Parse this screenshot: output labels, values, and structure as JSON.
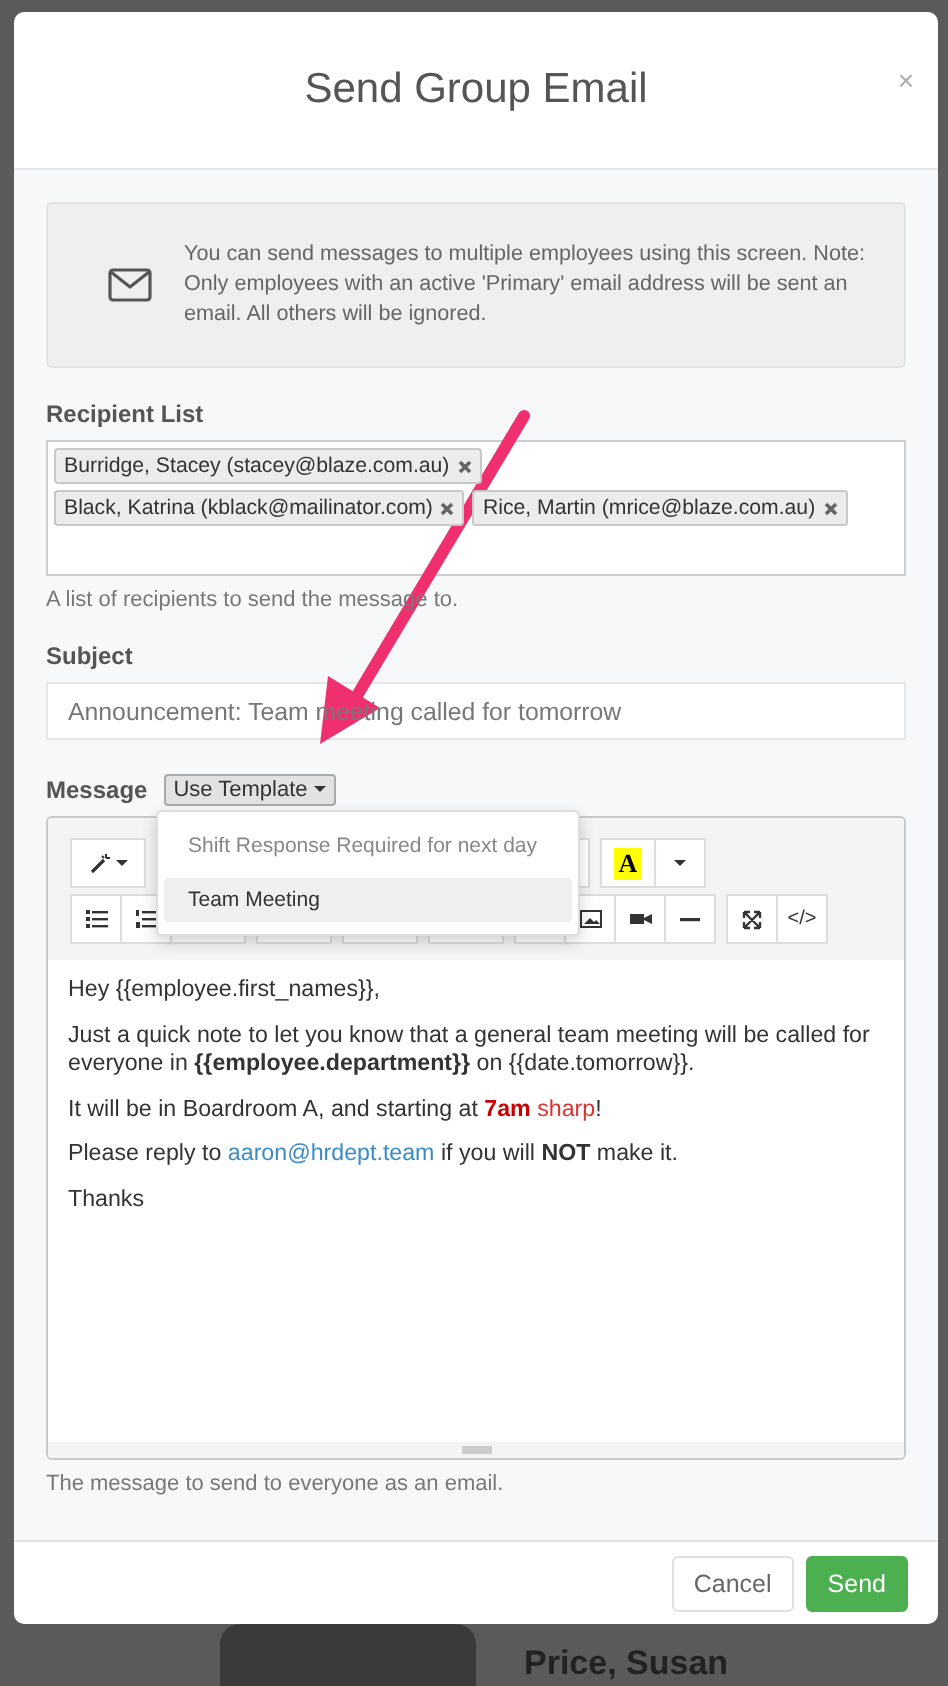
{
  "window": {
    "title": "Send Group Email",
    "close": "×"
  },
  "info": {
    "text": "You can send messages to multiple employees using this screen. Note: Only employees with an active 'Primary' email address will be sent an email. All others will be ignored."
  },
  "recipients": {
    "label": "Recipient List",
    "tokens": [
      {
        "text": "Burridge, Stacey (stacey@blaze.com.au)"
      },
      {
        "text": "Black, Katrina (kblack@mailinator.com)"
      },
      {
        "text": "Rice, Martin (mrice@blaze.com.au)"
      }
    ],
    "help": "A list of recipients to send the message to."
  },
  "subject": {
    "label": "Subject",
    "value": "Announcement: Team meeting called for tomorrow"
  },
  "message": {
    "label": "Message",
    "template_button": "Use Template",
    "templates": [
      {
        "label": "Shift Response Required for next day",
        "selected": false
      },
      {
        "label": "Team Meeting",
        "selected": true
      }
    ],
    "toolbar": {
      "highlight_glyph": "A",
      "code_glyph": "</>"
    },
    "paragraphs": [
      [
        {
          "kind": "plain",
          "text": "Hey {{employee.first_names}},"
        }
      ],
      [
        {
          "kind": "plain",
          "text": "Just a quick note to let you know that a general team meeting will be called for everyone in "
        },
        {
          "kind": "strong",
          "text": "{{employee.department}}"
        },
        {
          "kind": "plain",
          "text": " on {{date.tomorrow}}."
        }
      ],
      [
        {
          "kind": "plain",
          "text": "It will be in Boardroom A, and starting at "
        },
        {
          "kind": "alert-strong",
          "text": "7am"
        },
        {
          "kind": "alert",
          "text": " sharp"
        },
        {
          "kind": "plain",
          "text": "!"
        }
      ],
      [
        {
          "kind": "plain",
          "text": "Please reply to "
        },
        {
          "kind": "link",
          "text": "aaron@hrdept.team"
        },
        {
          "kind": "plain",
          "text": " if you will "
        },
        {
          "kind": "strong",
          "text": "NOT"
        },
        {
          "kind": "plain",
          "text": " make it."
        }
      ],
      [
        {
          "kind": "plain",
          "text": "Thanks"
        }
      ]
    ],
    "help": "The message to send to everyone as an email."
  },
  "footer": {
    "buttons": [
      {
        "label": "Cancel",
        "kind": "default"
      },
      {
        "label": "Send",
        "kind": "primary"
      }
    ]
  },
  "backdrop": {
    "text": "Price, Susan"
  }
}
